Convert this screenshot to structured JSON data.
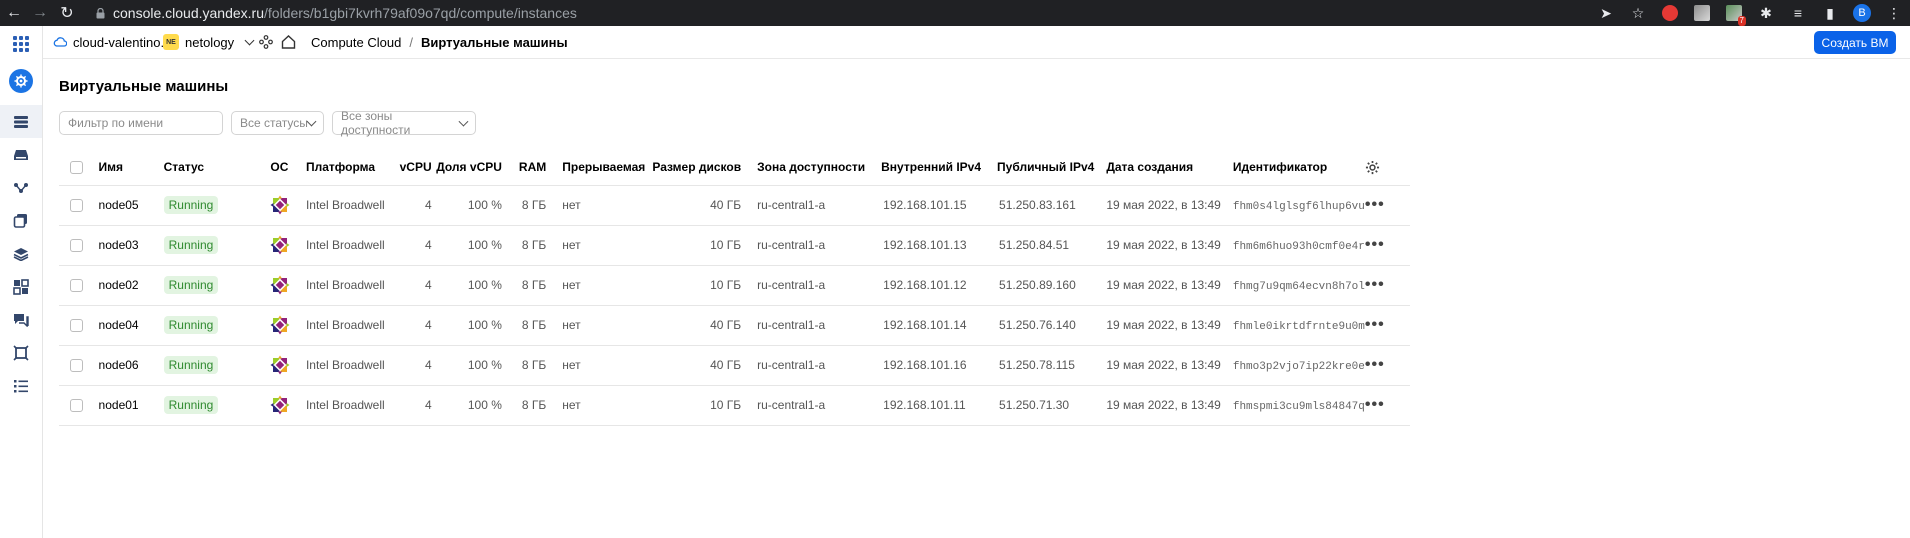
{
  "browser": {
    "url_host": "console.cloud.yandex.ru",
    "url_path": "/folders/b1gbi7kvrh79af09o7qd/compute/instances",
    "extension_badge": "7",
    "profile_initial": "B"
  },
  "header": {
    "cloud": "cloud-valentino...",
    "folder_badge": "NE",
    "folder": "netology",
    "service": "Compute Cloud",
    "separator": "/",
    "current_page": "Виртуальные машины",
    "create_button": "Создать ВМ"
  },
  "page": {
    "title": "Виртуальные машины",
    "filter_placeholder": "Фильтр по имени",
    "status_filter": "Все статусы",
    "zone_filter": "Все зоны доступности"
  },
  "table": {
    "columns": [
      "Имя",
      "Статус",
      "ОС",
      "Платформа",
      "vCPU",
      "Доля vCPU",
      "RAM",
      "Прерываемая",
      "Размер дисков",
      "Зона доступности",
      "Внутренний IPv4",
      "Публичный IPv4",
      "Дата создания",
      "Идентификатор"
    ],
    "rows": [
      {
        "name": "node05",
        "status": "Running",
        "platform": "Intel Broadwell",
        "vcpu": "4",
        "share": "100 %",
        "ram": "8 ГБ",
        "preemptible": "нет",
        "disk": "40 ГБ",
        "zone": "ru-central1-a",
        "internal_ip": "192.168.101.15",
        "public_ip": "51.250.83.161",
        "created": "19 мая 2022, в 13:49",
        "id": "fhm0s4lglsgf6lhup6vu"
      },
      {
        "name": "node03",
        "status": "Running",
        "platform": "Intel Broadwell",
        "vcpu": "4",
        "share": "100 %",
        "ram": "8 ГБ",
        "preemptible": "нет",
        "disk": "10 ГБ",
        "zone": "ru-central1-a",
        "internal_ip": "192.168.101.13",
        "public_ip": "51.250.84.51",
        "created": "19 мая 2022, в 13:49",
        "id": "fhm6m6huo93h0cmf0e4r"
      },
      {
        "name": "node02",
        "status": "Running",
        "platform": "Intel Broadwell",
        "vcpu": "4",
        "share": "100 %",
        "ram": "8 ГБ",
        "preemptible": "нет",
        "disk": "10 ГБ",
        "zone": "ru-central1-a",
        "internal_ip": "192.168.101.12",
        "public_ip": "51.250.89.160",
        "created": "19 мая 2022, в 13:49",
        "id": "fhmg7u9qm64ecvn8h7ol"
      },
      {
        "name": "node04",
        "status": "Running",
        "platform": "Intel Broadwell",
        "vcpu": "4",
        "share": "100 %",
        "ram": "8 ГБ",
        "preemptible": "нет",
        "disk": "40 ГБ",
        "zone": "ru-central1-a",
        "internal_ip": "192.168.101.14",
        "public_ip": "51.250.76.140",
        "created": "19 мая 2022, в 13:49",
        "id": "fhmle0ikrtdfrnte9u0m"
      },
      {
        "name": "node06",
        "status": "Running",
        "platform": "Intel Broadwell",
        "vcpu": "4",
        "share": "100 %",
        "ram": "8 ГБ",
        "preemptible": "нет",
        "disk": "40 ГБ",
        "zone": "ru-central1-a",
        "internal_ip": "192.168.101.16",
        "public_ip": "51.250.78.115",
        "created": "19 мая 2022, в 13:49",
        "id": "fhmo3p2vjo7ip22kre0e"
      },
      {
        "name": "node01",
        "status": "Running",
        "platform": "Intel Broadwell",
        "vcpu": "4",
        "share": "100 %",
        "ram": "8 ГБ",
        "preemptible": "нет",
        "disk": "10 ГБ",
        "zone": "ru-central1-a",
        "internal_ip": "192.168.101.11",
        "public_ip": "51.250.71.30",
        "created": "19 мая 2022, в 13:49",
        "id": "fhmspmi3cu9mls84847q"
      }
    ]
  },
  "icons": {
    "os": "centos-logo-icon",
    "row_menu": "more-horizontal-icon",
    "settings": "gear-icon"
  },
  "colors": {
    "accent": "#0a62e8",
    "status_running_bg": "#e2f4e1",
    "status_running_text": "#2f8a2f"
  }
}
